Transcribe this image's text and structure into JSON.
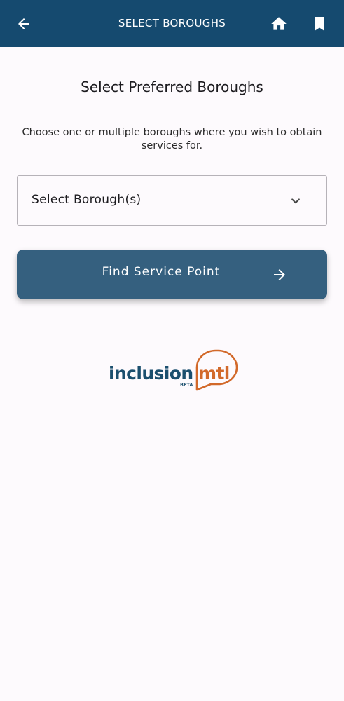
{
  "appbar": {
    "title": "SELECT BOROUGHS",
    "back_icon": "arrow-left-icon",
    "home_icon": "home-icon",
    "bookmark_icon": "bookmark-icon",
    "background_color": "#154a6f"
  },
  "main": {
    "heading": "Select Preferred Boroughs",
    "description": "Choose one or multiple boroughs where you wish to obtain services for.",
    "borough_select": {
      "placeholder": "Select Borough(s)",
      "icon": "chevron-down-icon"
    },
    "find_button": {
      "label": "Find Service Point",
      "icon": "arrow-right-icon",
      "background_color": "#35607f"
    }
  },
  "logo": {
    "text_primary": "inclusion",
    "text_secondary": "mtl",
    "badge": "BETA",
    "primary_color": "#1b4f6e",
    "accent_color": "#d2692a"
  }
}
